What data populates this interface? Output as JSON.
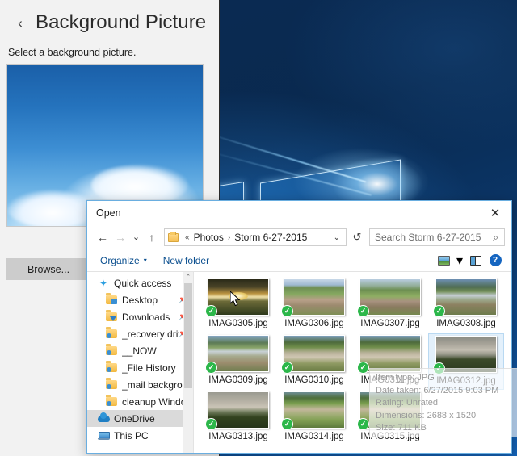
{
  "settings": {
    "back_icon": "back-chevron-icon",
    "title": "Background Picture",
    "subtitle": "Select a background picture.",
    "browse_label": "Browse...",
    "preview_alt": "blue sky with cloud background preview"
  },
  "dialog": {
    "title": "Open",
    "close_label": "✕",
    "nav": {
      "back": "←",
      "forward": "→",
      "recent": "⌄",
      "up": "↑"
    },
    "address": {
      "folder_icon": "folder-icon",
      "overflow": "«",
      "crumbs": [
        "Photos",
        "Storm 6-27-2015"
      ],
      "separator": "›",
      "dropdown": "⌄",
      "refresh": "↺"
    },
    "search": {
      "placeholder": "Search Storm 6-27-2015",
      "value": "",
      "icon": "search-icon"
    },
    "commandbar": {
      "organize_label": "Organize",
      "organize_caret": "▾",
      "new_folder_label": "New folder",
      "view_icon": "view-options-icon",
      "view_caret": "▾",
      "preview_pane_icon": "preview-pane-icon",
      "help_icon": "help-icon",
      "help_glyph": "?"
    },
    "navpane": {
      "items": [
        {
          "label": "Quick access",
          "icon": "star-icon",
          "pinned": false,
          "indent": false,
          "selected": false
        },
        {
          "label": "Desktop",
          "icon": "folder-desktop-icon",
          "pinned": true,
          "indent": true,
          "selected": false
        },
        {
          "label": "Downloads",
          "icon": "folder-downloads-icon",
          "pinned": true,
          "indent": true,
          "selected": false
        },
        {
          "label": "_recovery driv",
          "icon": "folder-icon",
          "pinned": true,
          "indent": true,
          "selected": false
        },
        {
          "label": "__NOW",
          "icon": "folder-icon",
          "pinned": false,
          "indent": true,
          "selected": false
        },
        {
          "label": "_File History",
          "icon": "folder-icon",
          "pinned": false,
          "indent": true,
          "selected": false
        },
        {
          "label": "_mail backgroun",
          "icon": "folder-icon",
          "pinned": false,
          "indent": true,
          "selected": false
        },
        {
          "label": "cleanup Window",
          "icon": "folder-icon",
          "pinned": false,
          "indent": true,
          "selected": false
        },
        {
          "label": "OneDrive",
          "icon": "onedrive-icon",
          "pinned": false,
          "indent": false,
          "selected": true
        },
        {
          "label": "This PC",
          "icon": "this-pc-icon",
          "pinned": false,
          "indent": false,
          "selected": false
        }
      ],
      "scrollbar": {
        "up_arrow": "⌃"
      }
    },
    "files": [
      {
        "name": "IMAG0305.jpg",
        "checked": true,
        "selected": false,
        "art": "t-sunset"
      },
      {
        "name": "IMAG0306.jpg",
        "checked": true,
        "selected": false,
        "art": "t-field1"
      },
      {
        "name": "IMAG0307.jpg",
        "checked": true,
        "selected": false,
        "art": "t-field2"
      },
      {
        "name": "IMAG0308.jpg",
        "checked": true,
        "selected": false,
        "art": "t-lake"
      },
      {
        "name": "IMAG0309.jpg",
        "checked": true,
        "selected": false,
        "art": "t-lake2"
      },
      {
        "name": "IMAG0310.jpg",
        "checked": true,
        "selected": false,
        "art": "t-flood"
      },
      {
        "name": "IMAG0311.jpg",
        "checked": true,
        "selected": false,
        "art": "t-flood"
      },
      {
        "name": "IMAG0312.jpg",
        "checked": true,
        "selected": true,
        "art": "t-storm"
      },
      {
        "name": "IMAG0313.jpg",
        "checked": true,
        "selected": false,
        "art": "t-storm2"
      },
      {
        "name": "IMAG0314.jpg",
        "checked": true,
        "selected": false,
        "art": "t-grass"
      },
      {
        "name": "IMAG0315.jpg",
        "checked": true,
        "selected": false,
        "art": "t-grass"
      }
    ],
    "check_glyph": "✓",
    "tooltip": {
      "lines": [
        "Item type: JPG",
        "Date taken: 6/27/2015 9:03 PM",
        "Rating: Unrated",
        "Dimensions: 2688 x 1520",
        "Size: 711 KB"
      ]
    }
  },
  "colors": {
    "accent_blue": "#0b4f8f",
    "selection_blue": "#e3f0fb",
    "check_green": "#2cb74a",
    "settings_bg": "#f2f2f2",
    "dialog_border": "#6aaee0"
  }
}
